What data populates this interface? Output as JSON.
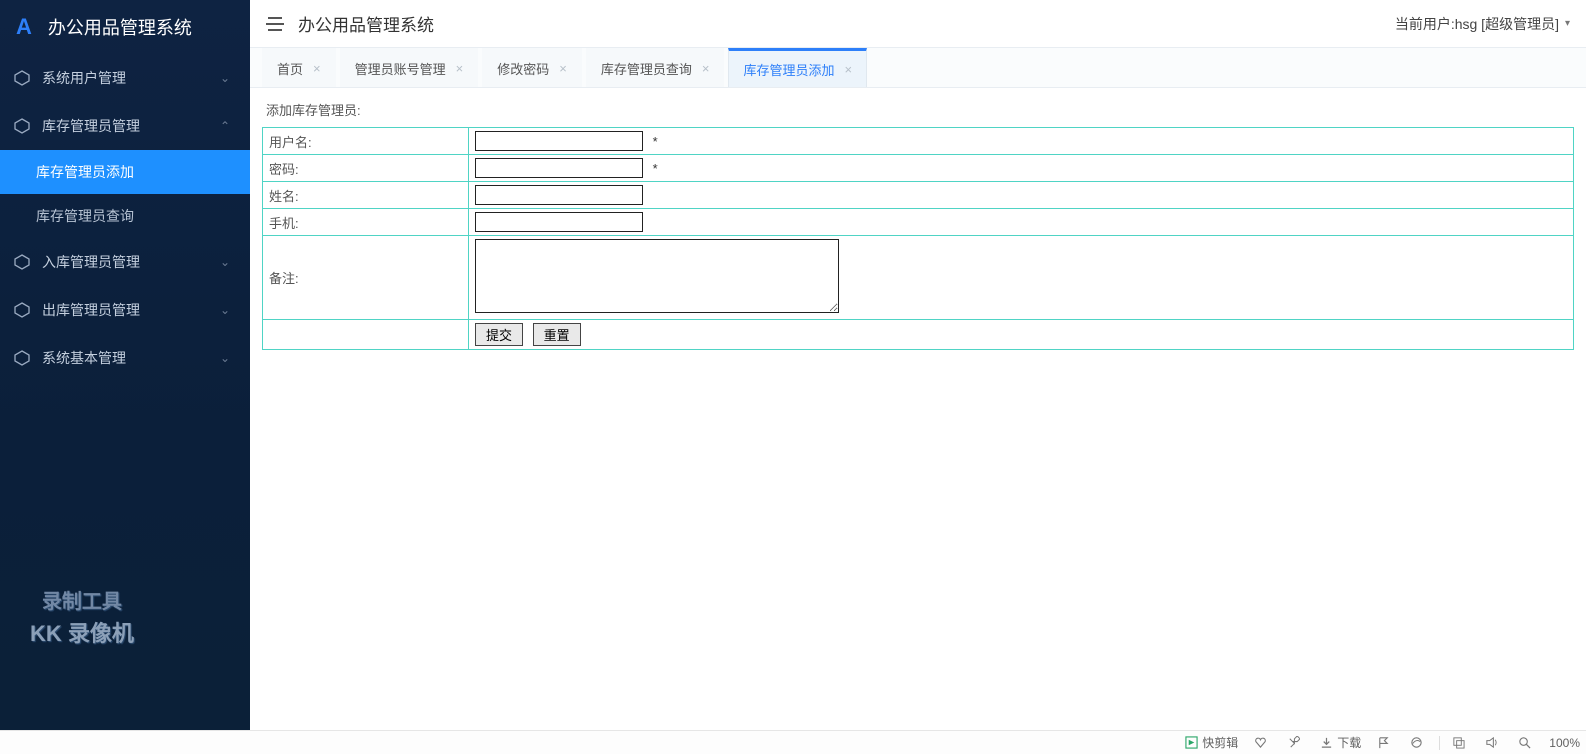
{
  "sidebar": {
    "title": "办公用品管理系统",
    "items": [
      {
        "label": "系统用户管理",
        "expanded": false
      },
      {
        "label": "库存管理员管理",
        "expanded": true,
        "children": [
          {
            "label": "库存管理员添加",
            "active": true
          },
          {
            "label": "库存管理员查询",
            "active": false
          }
        ]
      },
      {
        "label": "入库管理员管理",
        "expanded": false
      },
      {
        "label": "出库管理员管理",
        "expanded": false
      },
      {
        "label": "系统基本管理",
        "expanded": false
      }
    ],
    "watermark_line1": "录制工具",
    "watermark_line2": "KK 录像机"
  },
  "topbar": {
    "title": "办公用品管理系统",
    "user_label": "当前用户:hsg [超级管理员]"
  },
  "tabs": [
    {
      "label": "首页",
      "active": false
    },
    {
      "label": "管理员账号管理",
      "active": false
    },
    {
      "label": "修改密码",
      "active": false
    },
    {
      "label": "库存管理员查询",
      "active": false
    },
    {
      "label": "库存管理员添加",
      "active": true
    }
  ],
  "form": {
    "section_title": "添加库存管理员:",
    "rows": [
      {
        "label": "用户名:",
        "required": true
      },
      {
        "label": "密码:",
        "required": true
      },
      {
        "label": "姓名:",
        "required": false
      },
      {
        "label": "手机:",
        "required": false
      }
    ],
    "textarea_label": "备注:",
    "submit_label": "提交",
    "reset_label": "重置",
    "required_mark": "*"
  },
  "statusbar": {
    "quick_edit": "快剪辑",
    "download": "下载",
    "zoom": "100%"
  }
}
